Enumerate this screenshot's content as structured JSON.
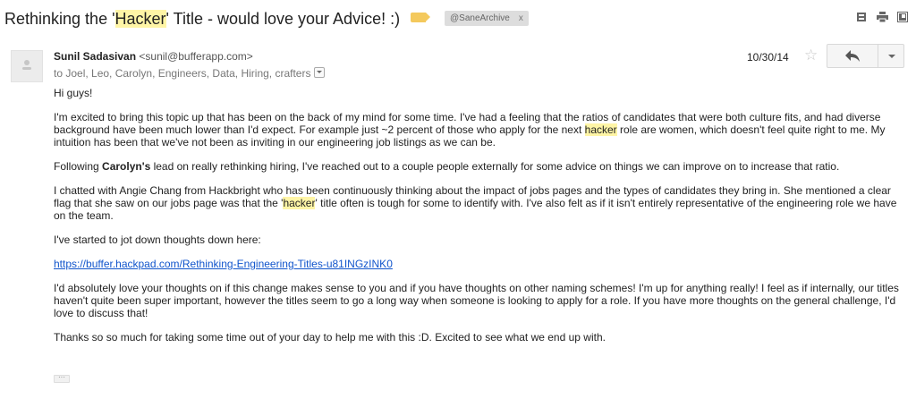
{
  "subject": {
    "before": "Rethinking the '",
    "highlight": "Hacker",
    "after": "' Title - would love your Advice! :)",
    "label_chip": "@SaneArchive",
    "label_chip_close": "x"
  },
  "toolbar_icons": [
    "print-all-icon",
    "print-icon",
    "new-window-icon"
  ],
  "message": {
    "sender_name": "Sunil Sadasivan",
    "sender_email": "<sunil@bufferapp.com>",
    "recipients": "to Joel, Leo, Carolyn, Engineers, Data, Hiring, crafters",
    "date": "10/30/14",
    "star": "☆"
  },
  "body": {
    "greeting": "Hi guys!",
    "p1_a": "I'm excited to bring this topic up that has been on the back of my mind for some time.  I've had a feeling that the ratios of candidates that were both culture fits, and had diverse background have been much lower than I'd expect.  For example just ~2 percent of those who apply for the next ",
    "p1_hl": "hacker",
    "p1_b": " role are women, which doesn't feel quite right to me.  My intuition has been that we've not been as inviting in our engineering job listings as we can be.",
    "p2_a": "Following ",
    "p2_bold": "Carolyn's",
    "p2_b": " lead on really rethinking hiring, I've reached out to a couple people externally for some advice on things we can improve on to increase that ratio.",
    "p3_a": "I chatted with Angie Chang from Hackbright who has been continuously thinking about the impact of jobs pages and the types of candidates they bring in.  She mentioned a clear flag  that she saw on our jobs page was that the '",
    "p3_hl": "hacker",
    "p3_b": "' title often is tough for some to identify with.  I've also felt as if it isn't entirely representative of the engineering role we have on the team.",
    "p4": "I've started to jot down thoughts down here:",
    "link": "https://buffer.hackpad.com/Rethinking-Engineering-Titles-u81INGzINK0",
    "p5": "I'd absolutely love your thoughts on if this change makes sense to you and if you have thoughts on other naming schemes!  I'm up for anything really!  I feel as if internally, our titles haven't quite been super important, however the titles seem to go a long way when someone is looking to apply for a role. If you have more thoughts on the general challenge, I'd love to discuss that!",
    "p6": "Thanks so so much for taking some time out of your day to help me with this :D.  Excited to see what we end up with.",
    "ellipsis": "···"
  },
  "colors": {
    "highlight": "#fff5a6",
    "link": "#1155cc",
    "label": "#f4c95d"
  }
}
